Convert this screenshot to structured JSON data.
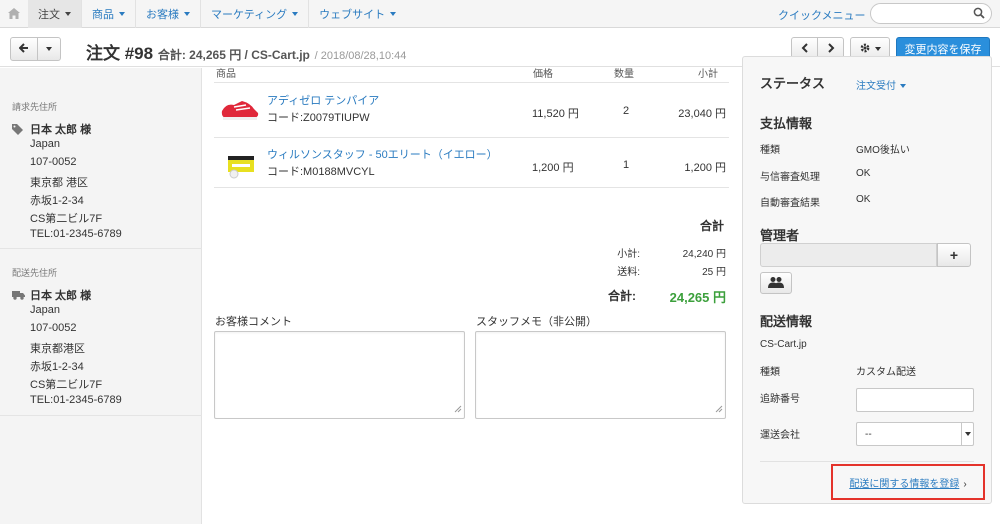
{
  "nav": {
    "items": [
      {
        "label": "注文",
        "active": true
      },
      {
        "label": "商品"
      },
      {
        "label": "お客様"
      },
      {
        "label": "マーケティング"
      },
      {
        "label": "ウェブサイト"
      }
    ],
    "quick_menu": "クイックメニュー",
    "search_placeholder": ""
  },
  "header": {
    "title": "注文 #98",
    "subtitle": "合計: 24,265 円 / CS-Cart.jp",
    "date": "/ 2018/08/28,10:44",
    "save_label": "変更内容を保存"
  },
  "billing": {
    "section_label": "請求先住所",
    "name": "日本 太郎 様",
    "lines": [
      "Japan",
      "107-0052",
      "東京都 港区",
      "赤坂1-2-34",
      "CS第二ビル7F",
      "TEL:01-2345-6789"
    ]
  },
  "shipping_addr": {
    "section_label": "配送先住所",
    "name": "日本 太郎 様",
    "lines": [
      "Japan",
      "107-0052",
      "東京都港区",
      "赤坂1-2-34",
      "CS第二ビル7F",
      "TEL:01-2345-6789"
    ]
  },
  "products": {
    "headers": {
      "product": "商品",
      "price": "価格",
      "qty": "数量",
      "subtotal": "小計"
    },
    "rows": [
      {
        "name": "アディゼロ テンパイア",
        "code": "コード:Z0079TIUPW",
        "price": "11,520 円",
        "qty": "2",
        "subtotal": "23,040 円"
      },
      {
        "name": "ウィルソンスタッフ - 50エリート（イエロー）",
        "code": "コード:M0188MVCYL",
        "price": "1,200 円",
        "qty": "1",
        "subtotal": "1,200 円"
      }
    ]
  },
  "totals": {
    "heading": "合計",
    "subtotal_label": "小計:",
    "subtotal_value": "24,240 円",
    "shipping_label": "送料:",
    "shipping_value": "25 円",
    "total_label": "合計:",
    "total_value": "24,265 円"
  },
  "comments": {
    "customer_label": "お客様コメント",
    "staff_label": "スタッフメモ（非公開）"
  },
  "sidebar": {
    "status_heading": "ステータス",
    "status_value": "注文受付",
    "payment_heading": "支払情報",
    "payment": [
      {
        "key": "種類",
        "value": "GMO後払い"
      },
      {
        "key": "与信審査処理",
        "value": "OK"
      },
      {
        "key": "自動審査結果",
        "value": "OK"
      }
    ],
    "manager_heading": "管理者",
    "shipping_heading": "配送情報",
    "carrier_name": "CS-Cart.jp",
    "ship_type_key": "種類",
    "ship_type_value": "カスタム配送",
    "tracking_key": "追跡番号",
    "tracking_value": "",
    "company_key": "運送会社",
    "company_value": "--",
    "register_link": "配送に関する情報を登録"
  },
  "colors": {
    "link": "#2a7bc0",
    "primary_button": "#2a8fdc",
    "total_green": "#3ca03c",
    "highlight_red": "#e4332b"
  }
}
